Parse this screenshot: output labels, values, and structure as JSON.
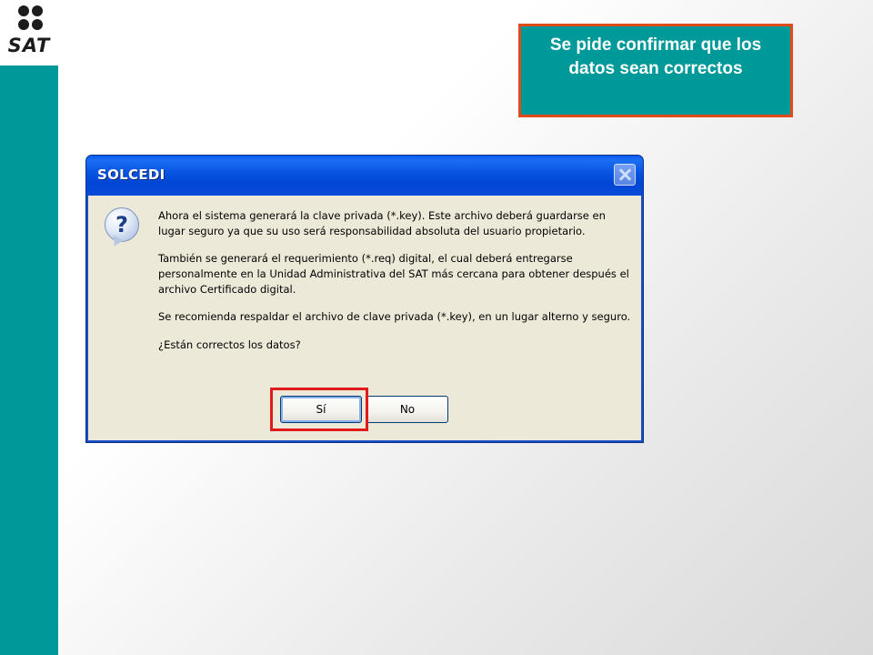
{
  "logo": {
    "text": "SAT"
  },
  "callout": {
    "text": "Se pide confirmar que los datos sean correctos"
  },
  "dialog": {
    "title": "SOLCEDI",
    "icon": "question-icon",
    "paragraphs": [
      "Ahora el sistema generará la clave privada (*.key). Este archivo deberá guardarse en lugar seguro ya que su uso será responsabilidad absoluta del usuario propietario.",
      "También se generará el requerimiento (*.req) digital, el cual deberá entregarse personalmente en la Unidad Administrativa del SAT más cercana para obtener después el archivo Certificado digital.",
      "Se recomienda respaldar el archivo de clave privada (*.key), en un lugar alterno y seguro.",
      "¿Están correctos los datos?"
    ],
    "buttons": {
      "yes": "Sí",
      "no": "No"
    }
  },
  "colors": {
    "teal": "#00999a",
    "callout_border": "#e24a1a",
    "highlight": "#e11b1b",
    "titlebar": "#0a56e4",
    "dialog_bg": "#ece9d8"
  }
}
